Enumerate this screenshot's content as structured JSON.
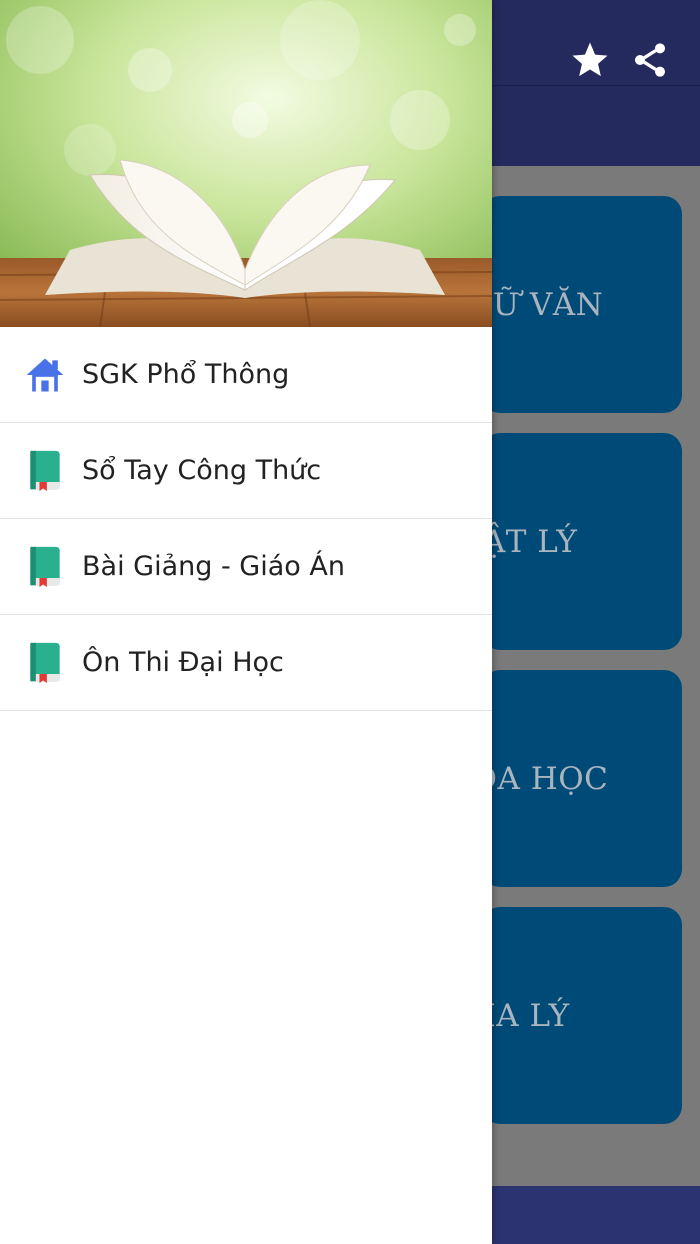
{
  "toolbar": {
    "icons": [
      "star-icon",
      "share-icon"
    ],
    "color": "#252a5e"
  },
  "subjects": [
    {
      "label": "NGỮ VĂN"
    },
    {
      "label": "VẬT LÝ"
    },
    {
      "label": "HÓA HỌC"
    },
    {
      "label": "ĐỊA LÝ"
    }
  ],
  "drawer": {
    "header_image": "open-book-on-wooden-table",
    "items": [
      {
        "label": "SGK Phổ Thông",
        "icon": "home-icon"
      },
      {
        "label": "Sổ Tay Công Thức",
        "icon": "book-icon"
      },
      {
        "label": "Bài Giảng - Giáo Án",
        "icon": "book-icon"
      },
      {
        "label": "Ôn Thi Đại Học",
        "icon": "book-icon"
      }
    ]
  },
  "colors": {
    "card": "#004a78",
    "bottom_bar": "#2c3371",
    "home_icon": "#4a72e8",
    "book_icon": "#29b08f"
  }
}
